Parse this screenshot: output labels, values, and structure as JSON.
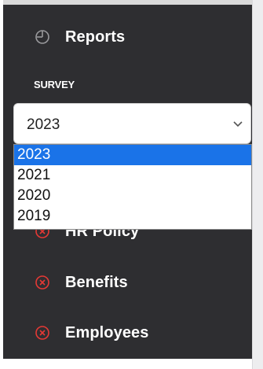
{
  "sidebar": {
    "reports_label": "Reports",
    "section_label": "SURVEY",
    "hidden_item_label": "HR Policy",
    "benefits_label": "Benefits",
    "employees_label": "Employees"
  },
  "survey_select": {
    "value": "2023",
    "options": [
      "2023",
      "2021",
      "2020",
      "2019"
    ]
  },
  "colors": {
    "sidebar_bg": "#2e2e31",
    "error_icon": "#e53935",
    "selected_option": "#1a73e8"
  }
}
